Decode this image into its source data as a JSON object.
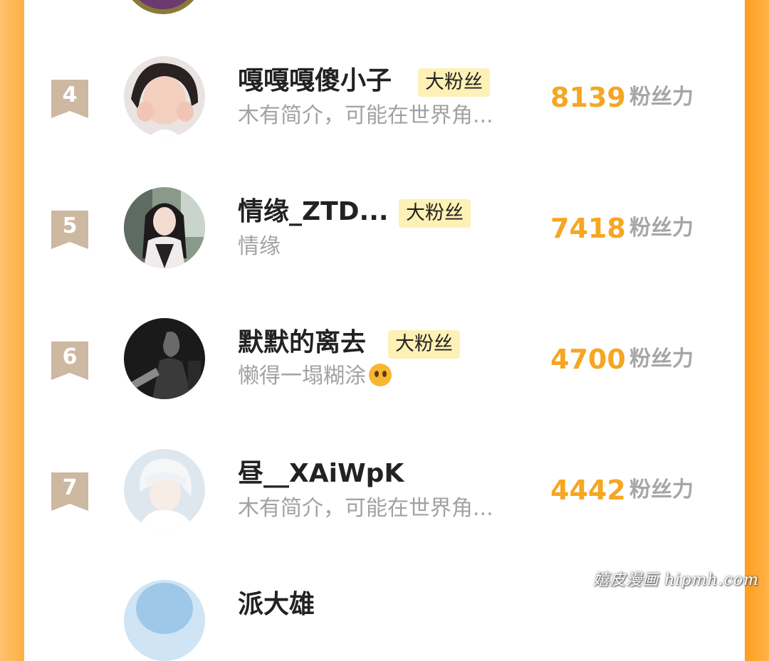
{
  "list": [
    {
      "rank": "4",
      "name": "嘎嘎嘎傻小子",
      "badge": "大粉丝",
      "bio": "木有简介，可能在世界角...",
      "score": "8139",
      "unit": "粉丝力"
    },
    {
      "rank": "5",
      "name": "情缘_ZTD...",
      "badge": "大粉丝",
      "bio": "情缘",
      "score": "7418",
      "unit": "粉丝力"
    },
    {
      "rank": "6",
      "name": "默默的离去",
      "badge": "大粉丝",
      "bio": "懒得一塌糊涂",
      "score": "4700",
      "unit": "粉丝力"
    },
    {
      "rank": "7",
      "name": "昼__XAiWpK",
      "badge": "",
      "bio": "木有简介，可能在世界角...",
      "score": "4442",
      "unit": "粉丝力"
    },
    {
      "name": "派大雄"
    }
  ],
  "watermark": "嬉皮漫画 hipmh.com",
  "colors": {
    "score": "#f5a623",
    "badge_bg": "#fdf1b6",
    "rank_ribbon": "#cdb8a1",
    "frame": "#ffa52c"
  }
}
